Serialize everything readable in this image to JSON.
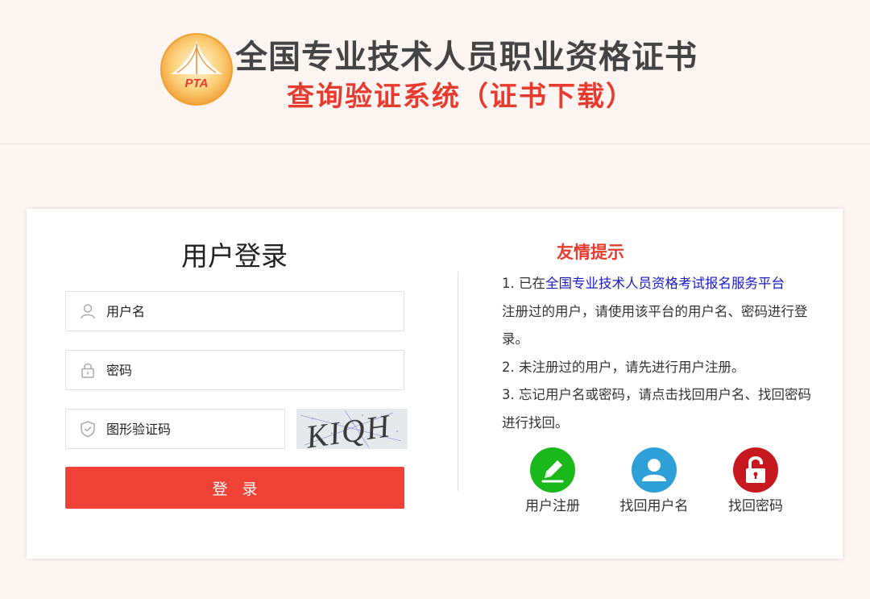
{
  "header": {
    "logo_text": "PTA",
    "title_main": "全国专业技术人员职业资格证书",
    "title_sub": "查询验证系统（证书下载）"
  },
  "login": {
    "title": "用户登录",
    "username_placeholder": "用户名",
    "password_placeholder": "密码",
    "captcha_placeholder": "图形验证码",
    "captcha_text": "KIQH",
    "submit_label": "登录"
  },
  "tips": {
    "title": "友情提示",
    "item1_prefix": "1. 已在",
    "item1_link": "全国专业技术人员资格考试报名服务平台",
    "item1_suffix": "注册过的用户，请使用该平台的用户名、密码进行登录。",
    "item2": "2. 未注册过的用户，请先进行用户注册。",
    "item3": "3. 忘记用户名或密码，请点击找回用户名、找回密码进行找回。"
  },
  "quick_links": {
    "register_label": "用户注册",
    "recover_username_label": "找回用户名",
    "recover_password_label": "找回密码"
  },
  "colors": {
    "accent_red": "#ef4136",
    "register_green": "#1ab81a",
    "user_blue": "#2f9fd8",
    "lock_red": "#c8181f"
  }
}
